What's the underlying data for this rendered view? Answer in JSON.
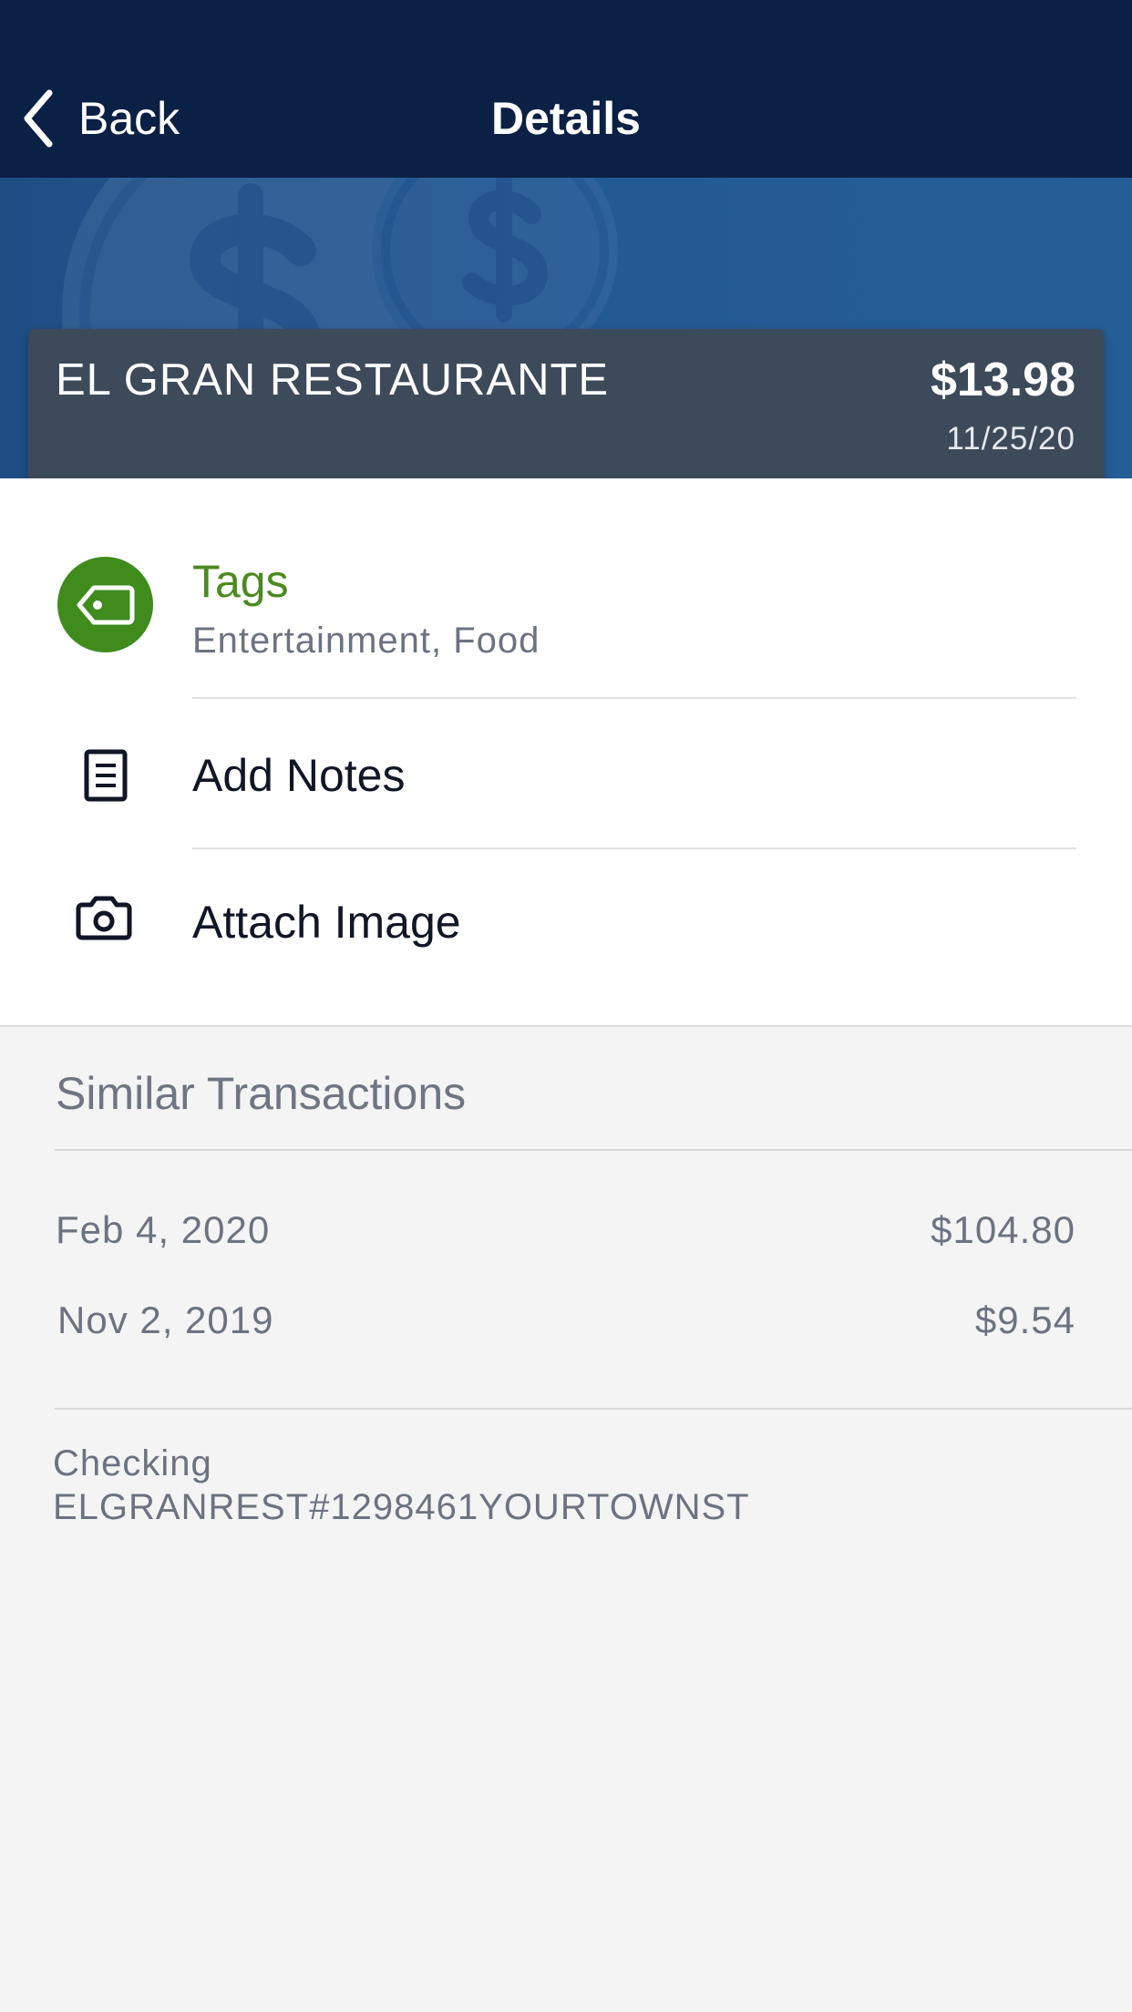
{
  "nav": {
    "back_label": "Back",
    "title": "Details"
  },
  "colors": {
    "nav_background": "#0b2045",
    "hero_background": "#235a93",
    "tag_accent": "#3f8c1d",
    "card_background": "#3d4a5a"
  },
  "transaction": {
    "merchant": "EL GRAN RESTAURANTE",
    "amount": "$13.98",
    "date": "11/25/20"
  },
  "actions": {
    "tags": {
      "icon": "tag-icon",
      "label": "Tags",
      "value": "Entertainment, Food"
    },
    "notes": {
      "icon": "document-icon",
      "label": "Add Notes"
    },
    "image": {
      "icon": "camera-icon",
      "label": "Attach Image"
    }
  },
  "similar": {
    "title": "Similar Transactions",
    "items": [
      {
        "date": "Feb 4, 2020",
        "amount": "$104.80"
      },
      {
        "date": "Nov 2, 2019",
        "amount": "$9.54"
      }
    ]
  },
  "details": {
    "account": "Checking",
    "description": "ELGRANREST#1298461YOURTOWNST"
  }
}
